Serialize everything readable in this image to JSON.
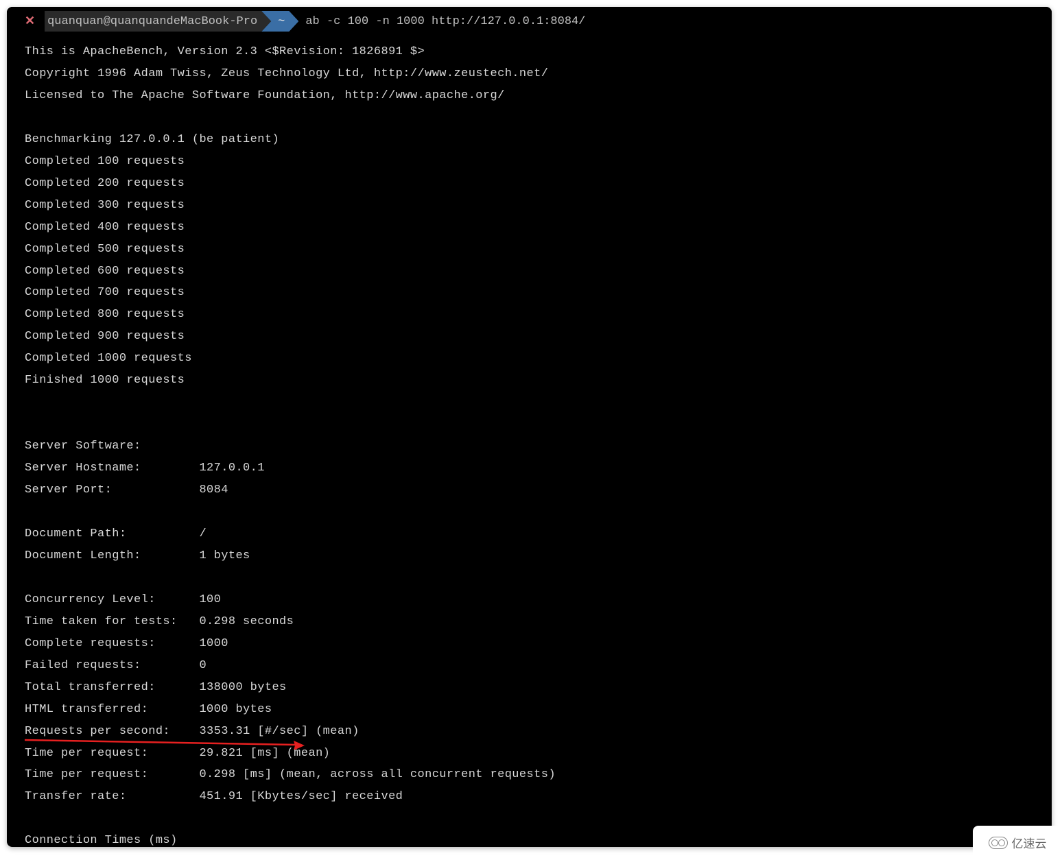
{
  "titlebar": {
    "close_glyph": "✕",
    "host": "quanquan@quanquandeMacBook-Pro",
    "cwd": "~",
    "command": "ab -c 100 -n 1000 http://127.0.0.1:8084/"
  },
  "header_lines": [
    "This is ApacheBench, Version 2.3 <$Revision: 1826891 $>",
    "Copyright 1996 Adam Twiss, Zeus Technology Ltd, http://www.zeustech.net/",
    "Licensed to The Apache Software Foundation, http://www.apache.org/"
  ],
  "benchmark_line": "Benchmarking 127.0.0.1 (be patient)",
  "progress_lines": [
    "Completed 100 requests",
    "Completed 200 requests",
    "Completed 300 requests",
    "Completed 400 requests",
    "Completed 500 requests",
    "Completed 600 requests",
    "Completed 700 requests",
    "Completed 800 requests",
    "Completed 900 requests",
    "Completed 1000 requests",
    "Finished 1000 requests"
  ],
  "results": [
    {
      "label": "Server Software:",
      "value": ""
    },
    {
      "label": "Server Hostname:",
      "value": "127.0.0.1"
    },
    {
      "label": "Server Port:",
      "value": "8084"
    },
    {
      "label": "",
      "value": ""
    },
    {
      "label": "Document Path:",
      "value": "/"
    },
    {
      "label": "Document Length:",
      "value": "1 bytes"
    },
    {
      "label": "",
      "value": ""
    },
    {
      "label": "Concurrency Level:",
      "value": "100"
    },
    {
      "label": "Time taken for tests:",
      "value": "0.298 seconds"
    },
    {
      "label": "Complete requests:",
      "value": "1000"
    },
    {
      "label": "Failed requests:",
      "value": "0"
    },
    {
      "label": "Total transferred:",
      "value": "138000 bytes"
    },
    {
      "label": "HTML transferred:",
      "value": "1000 bytes"
    },
    {
      "label": "Requests per second:",
      "value": "3353.31 [#/sec] (mean)"
    },
    {
      "label": "Time per request:",
      "value": "29.821 [ms] (mean)"
    },
    {
      "label": "Time per request:",
      "value": "0.298 [ms] (mean, across all concurrent requests)"
    },
    {
      "label": "Transfer rate:",
      "value": "451.91 [Kbytes/sec] received"
    }
  ],
  "footer_line": "Connection Times (ms)",
  "watermark": "亿速云"
}
